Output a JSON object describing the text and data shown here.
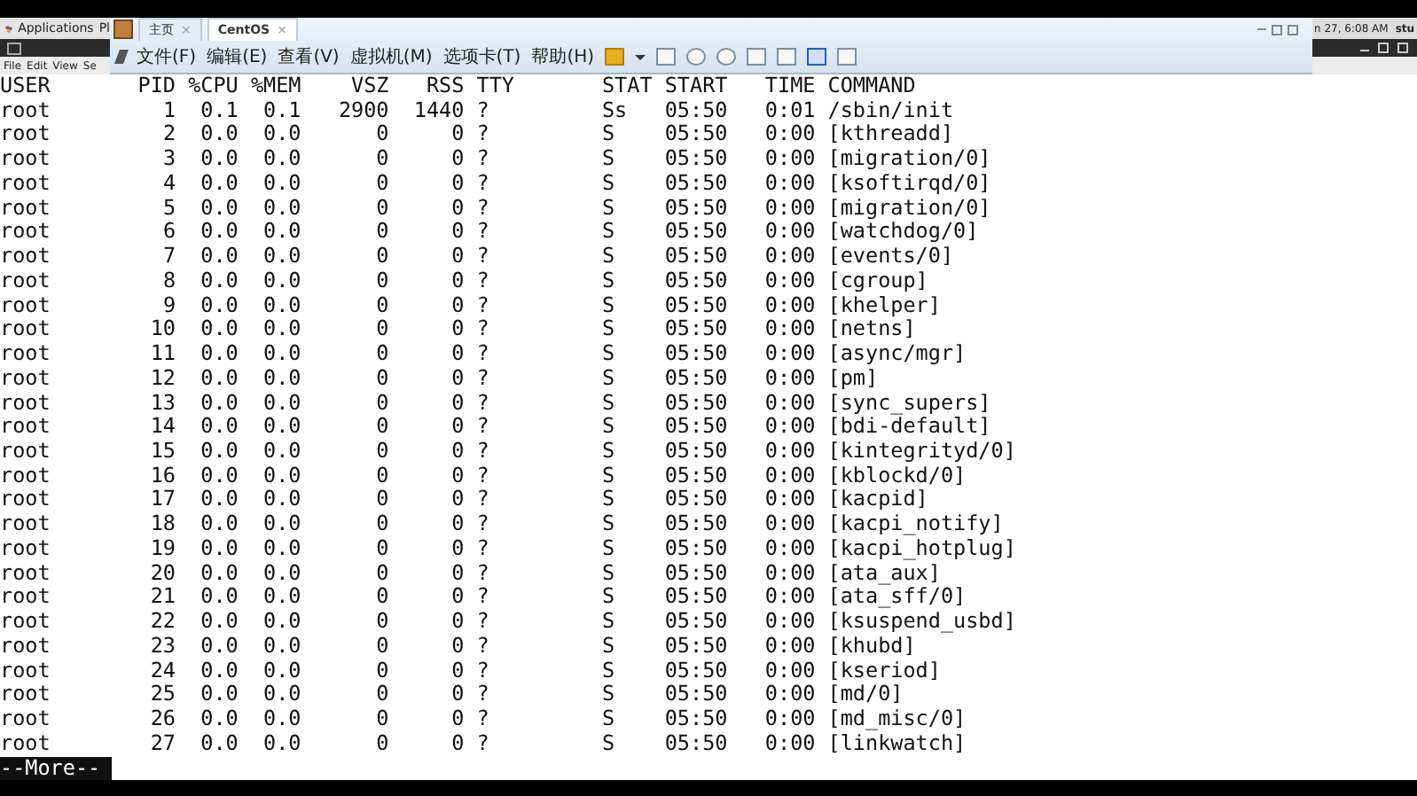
{
  "desktop_panel": {
    "menu": "Applications",
    "menu_2": "Pl",
    "clock": "n 27, 6:08 AM",
    "user": "stu"
  },
  "terminal_menu": [
    "File",
    "Edit",
    "View",
    "Se"
  ],
  "vmware": {
    "tabs": [
      {
        "label": "主页",
        "selected": false,
        "close": "×"
      },
      {
        "label": "CentOS",
        "selected": true,
        "close": "×"
      }
    ],
    "menu": [
      "文件(F)",
      "编辑(E)",
      "查看(V)",
      "虚拟机(M)",
      "选项卡(T)",
      "帮助(H)"
    ]
  },
  "terminal": {
    "columns": [
      "USER",
      "PID",
      "%CPU",
      "%MEM",
      "VSZ",
      "RSS",
      "TTY",
      "STAT",
      "START",
      "TIME",
      "COMMAND"
    ],
    "rows": [
      [
        "root",
        "1",
        "0.1",
        "0.1",
        "2900",
        "1440",
        "?",
        "Ss",
        "05:50",
        "0:01",
        "/sbin/init"
      ],
      [
        "root",
        "2",
        "0.0",
        "0.0",
        "0",
        "0",
        "?",
        "S",
        "05:50",
        "0:00",
        "[kthreadd]"
      ],
      [
        "root",
        "3",
        "0.0",
        "0.0",
        "0",
        "0",
        "?",
        "S",
        "05:50",
        "0:00",
        "[migration/0]"
      ],
      [
        "root",
        "4",
        "0.0",
        "0.0",
        "0",
        "0",
        "?",
        "S",
        "05:50",
        "0:00",
        "[ksoftirqd/0]"
      ],
      [
        "root",
        "5",
        "0.0",
        "0.0",
        "0",
        "0",
        "?",
        "S",
        "05:50",
        "0:00",
        "[migration/0]"
      ],
      [
        "root",
        "6",
        "0.0",
        "0.0",
        "0",
        "0",
        "?",
        "S",
        "05:50",
        "0:00",
        "[watchdog/0]"
      ],
      [
        "root",
        "7",
        "0.0",
        "0.0",
        "0",
        "0",
        "?",
        "S",
        "05:50",
        "0:00",
        "[events/0]"
      ],
      [
        "root",
        "8",
        "0.0",
        "0.0",
        "0",
        "0",
        "?",
        "S",
        "05:50",
        "0:00",
        "[cgroup]"
      ],
      [
        "root",
        "9",
        "0.0",
        "0.0",
        "0",
        "0",
        "?",
        "S",
        "05:50",
        "0:00",
        "[khelper]"
      ],
      [
        "root",
        "10",
        "0.0",
        "0.0",
        "0",
        "0",
        "?",
        "S",
        "05:50",
        "0:00",
        "[netns]"
      ],
      [
        "root",
        "11",
        "0.0",
        "0.0",
        "0",
        "0",
        "?",
        "S",
        "05:50",
        "0:00",
        "[async/mgr]"
      ],
      [
        "root",
        "12",
        "0.0",
        "0.0",
        "0",
        "0",
        "?",
        "S",
        "05:50",
        "0:00",
        "[pm]"
      ],
      [
        "root",
        "13",
        "0.0",
        "0.0",
        "0",
        "0",
        "?",
        "S",
        "05:50",
        "0:00",
        "[sync_supers]"
      ],
      [
        "root",
        "14",
        "0.0",
        "0.0",
        "0",
        "0",
        "?",
        "S",
        "05:50",
        "0:00",
        "[bdi-default]"
      ],
      [
        "root",
        "15",
        "0.0",
        "0.0",
        "0",
        "0",
        "?",
        "S",
        "05:50",
        "0:00",
        "[kintegrityd/0]"
      ],
      [
        "root",
        "16",
        "0.0",
        "0.0",
        "0",
        "0",
        "?",
        "S",
        "05:50",
        "0:00",
        "[kblockd/0]"
      ],
      [
        "root",
        "17",
        "0.0",
        "0.0",
        "0",
        "0",
        "?",
        "S",
        "05:50",
        "0:00",
        "[kacpid]"
      ],
      [
        "root",
        "18",
        "0.0",
        "0.0",
        "0",
        "0",
        "?",
        "S",
        "05:50",
        "0:00",
        "[kacpi_notify]"
      ],
      [
        "root",
        "19",
        "0.0",
        "0.0",
        "0",
        "0",
        "?",
        "S",
        "05:50",
        "0:00",
        "[kacpi_hotplug]"
      ],
      [
        "root",
        "20",
        "0.0",
        "0.0",
        "0",
        "0",
        "?",
        "S",
        "05:50",
        "0:00",
        "[ata_aux]"
      ],
      [
        "root",
        "21",
        "0.0",
        "0.0",
        "0",
        "0",
        "?",
        "S",
        "05:50",
        "0:00",
        "[ata_sff/0]"
      ],
      [
        "root",
        "22",
        "0.0",
        "0.0",
        "0",
        "0",
        "?",
        "S",
        "05:50",
        "0:00",
        "[ksuspend_usbd]"
      ],
      [
        "root",
        "23",
        "0.0",
        "0.0",
        "0",
        "0",
        "?",
        "S",
        "05:50",
        "0:00",
        "[khubd]"
      ],
      [
        "root",
        "24",
        "0.0",
        "0.0",
        "0",
        "0",
        "?",
        "S",
        "05:50",
        "0:00",
        "[kseriod]"
      ],
      [
        "root",
        "25",
        "0.0",
        "0.0",
        "0",
        "0",
        "?",
        "S",
        "05:50",
        "0:00",
        "[md/0]"
      ],
      [
        "root",
        "26",
        "0.0",
        "0.0",
        "0",
        "0",
        "?",
        "S",
        "05:50",
        "0:00",
        "[md_misc/0]"
      ],
      [
        "root",
        "27",
        "0.0",
        "0.0",
        "0",
        "0",
        "?",
        "S",
        "05:50",
        "0:00",
        "[linkwatch]"
      ]
    ],
    "pager": "--More--"
  }
}
